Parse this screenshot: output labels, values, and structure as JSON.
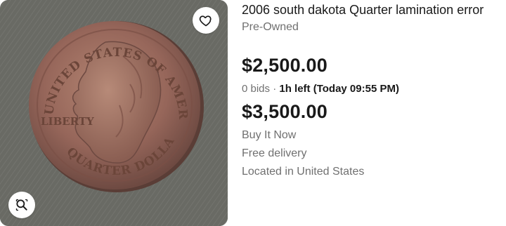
{
  "listing": {
    "title": "2006 south dakota Quarter lamination error",
    "condition": "Pre-Owned",
    "current_bid": "$2,500.00",
    "bids": "0 bids",
    "separator": "·",
    "time_left": "1h left (Today 09:55 PM)",
    "buy_it_now_price": "$3,500.00",
    "buy_format": "Buy It Now",
    "delivery": "Free delivery",
    "location": "Located in United States"
  },
  "image": {
    "coin_text_top": "UNITED STATES OF AMERICA",
    "coin_text_bottom": "QUARTER DOLLAR",
    "coin_text_liberty": "LIBERTY",
    "icons": {
      "favorite": "heart-icon",
      "zoom": "magnifier-icon"
    }
  },
  "colors": {
    "text_primary": "#191919",
    "text_secondary": "#707070",
    "photo_background": "#6f706a",
    "coin_copper": "#9a6a55"
  }
}
